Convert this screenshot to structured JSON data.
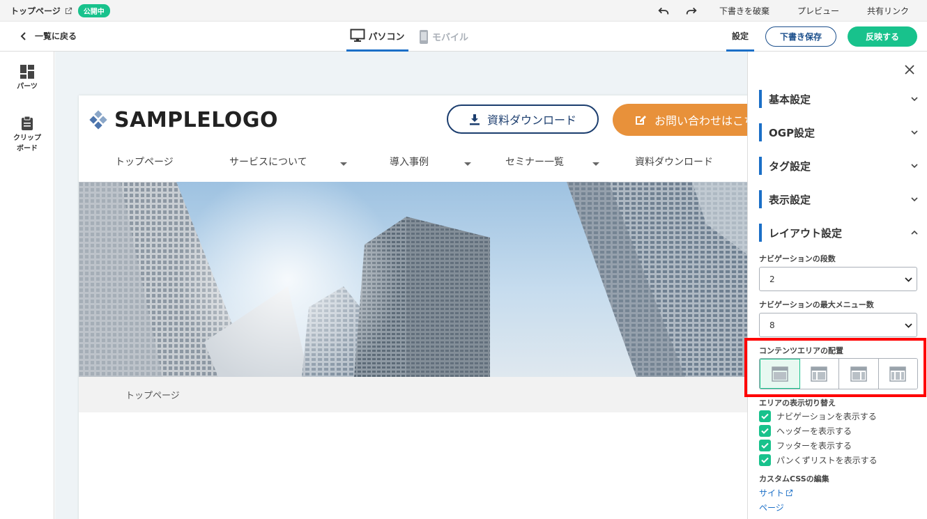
{
  "topbar": {
    "title": "トップページ",
    "status_badge": "公開中",
    "discard_label": "下書きを破棄",
    "preview_label": "プレビュー",
    "share_label": "共有リンク"
  },
  "subbar": {
    "back_label": "一覧に戻る",
    "device_pc": "パソコン",
    "device_mobile": "モバイル",
    "settings_tab": "設定",
    "save_draft_label": "下書き保存",
    "apply_label": "反映する"
  },
  "rail": {
    "parts_label": "パーツ",
    "clipboard_label_1": "クリップ",
    "clipboard_label_2": "ボード"
  },
  "site": {
    "logo": "SAMPLELOGO",
    "download_button": "資料ダウンロード",
    "contact_button": "お問い合わせはこちら",
    "nav": [
      {
        "label": "トップページ"
      },
      {
        "label": "サービスについて"
      },
      {
        "label": "導入事例"
      },
      {
        "label": "セミナー一覧"
      },
      {
        "label": "資料ダウンロード"
      }
    ],
    "breadcrumb": "トップページ"
  },
  "panel": {
    "sections": [
      {
        "label": "基本設定"
      },
      {
        "label": "OGP設定"
      },
      {
        "label": "タグ設定"
      },
      {
        "label": "表示設定"
      },
      {
        "label": "レイアウト設定"
      }
    ],
    "nav_rows_label": "ナビゲーションの段数",
    "nav_rows_value": "2",
    "nav_max_label": "ナビゲーションの最大メニュー数",
    "nav_max_value": "8",
    "content_area_label": "コンテンツエリアの配置",
    "area_toggle_label": "エリアの表示切り替え",
    "checkboxes": [
      {
        "label": "ナビゲーションを表示する"
      },
      {
        "label": "ヘッダーを表示する"
      },
      {
        "label": "フッターを表示する"
      },
      {
        "label": "パンくずリストを表示する"
      }
    ],
    "custom_css_label": "カスタムCSSの編集",
    "css_site_link": "サイト",
    "css_page_link": "ページ"
  },
  "colors": {
    "accent_green": "#18c28c",
    "accent_blue": "#1b6fc7",
    "navy": "#1b3d6e",
    "orange": "#e8913a",
    "highlight_red": "#ff0000"
  }
}
